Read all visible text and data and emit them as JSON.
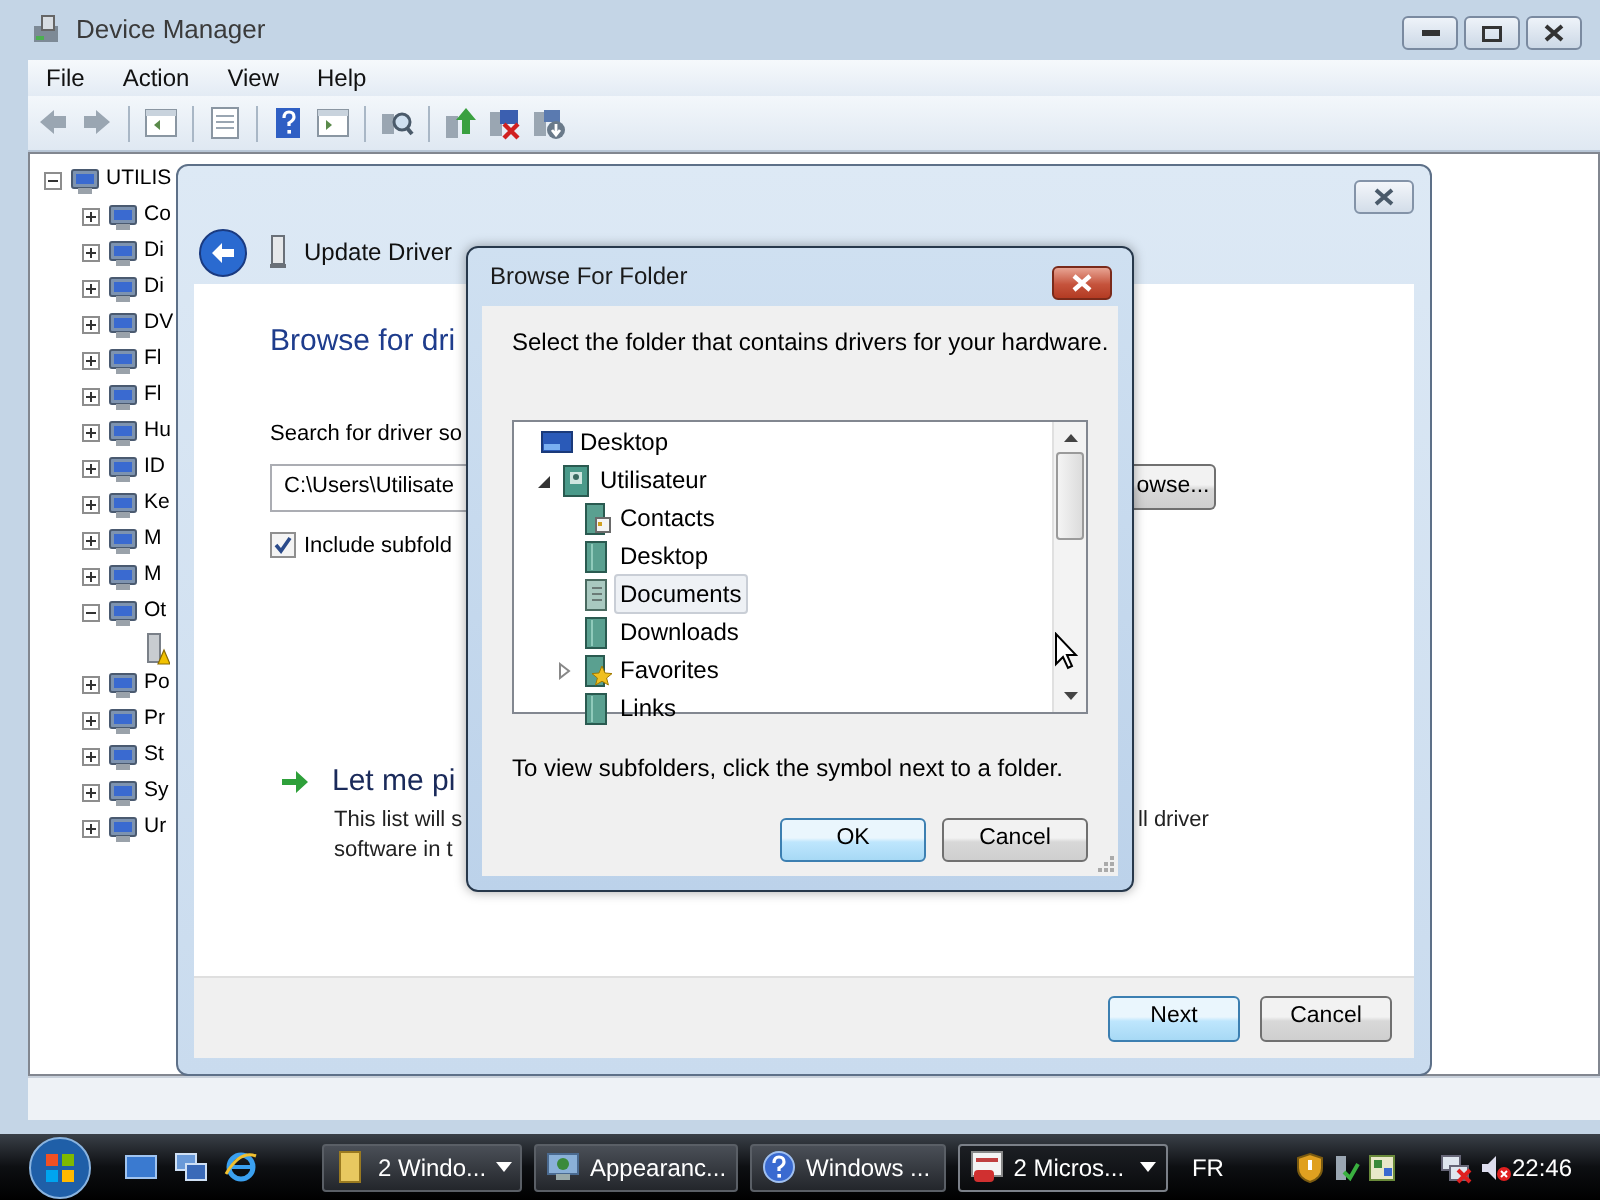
{
  "device_manager": {
    "title": "Device Manager",
    "menu": [
      "File",
      "Action",
      "View",
      "Help"
    ],
    "tree": {
      "label": "UTILIS",
      "expanded": true,
      "children": [
        {
          "label": "Co",
          "expanded": false
        },
        {
          "label": "Di",
          "expanded": false
        },
        {
          "label": "Di",
          "expanded": false
        },
        {
          "label": "DV",
          "expanded": false
        },
        {
          "label": "Fl",
          "expanded": false
        },
        {
          "label": "Fl",
          "expanded": false
        },
        {
          "label": "Hu",
          "expanded": false
        },
        {
          "label": "ID",
          "expanded": false
        },
        {
          "label": "Ke",
          "expanded": false
        },
        {
          "label": "M",
          "expanded": false
        },
        {
          "label": "M",
          "expanded": false
        },
        {
          "label": "Ot",
          "expanded": true,
          "children": [
            {
              "warning": true
            }
          ]
        },
        {
          "label": "Po",
          "expanded": false
        },
        {
          "label": "Pr",
          "expanded": false
        },
        {
          "label": "St",
          "expanded": false
        },
        {
          "label": "Sy",
          "expanded": false
        },
        {
          "label": "Ur",
          "expanded": false
        }
      ]
    }
  },
  "wizard": {
    "title": "Update Driver",
    "heading": "Browse for dri",
    "search_label": "Search for driver so",
    "path": "C:\\Users\\Utilisate",
    "browse_button": "owse...",
    "include_subfolders": {
      "label": "Include subfold",
      "checked": true
    },
    "pick_link": "Let me pi",
    "pick_description": [
      "This list will s",
      "software in t"
    ],
    "pick_description_right": "ll driver",
    "buttons": [
      "Next",
      "Cancel"
    ]
  },
  "browse_dialog": {
    "title": "Browse For Folder",
    "instruction": "Select the folder that contains drivers for your hardware.",
    "tree": [
      {
        "label": "Desktop",
        "kind": "desktop",
        "selected": false,
        "children": [
          {
            "label": "Utilisateur",
            "kind": "user",
            "selected": false,
            "expanded": true,
            "children": [
              {
                "label": "Contacts",
                "kind": "contacts",
                "selected": false
              },
              {
                "label": "Desktop",
                "kind": "folder",
                "selected": false
              },
              {
                "label": "Documents",
                "kind": "documents",
                "selected": true
              },
              {
                "label": "Downloads",
                "kind": "folder",
                "selected": false
              },
              {
                "label": "Favorites",
                "kind": "favorites",
                "selected": false,
                "expanded": false
              },
              {
                "label": "Links",
                "kind": "folder",
                "selected": false
              }
            ]
          }
        ]
      }
    ],
    "hint": "To view subfolders, click the symbol next to a folder.",
    "buttons": [
      "OK",
      "Cancel"
    ]
  },
  "taskbar": {
    "tasks": [
      {
        "label": "2 Windo...",
        "kind": "folder",
        "grouped": true,
        "selected": false
      },
      {
        "label": "Appearanc...",
        "kind": "display",
        "grouped": false,
        "selected": false
      },
      {
        "label": "Windows ...",
        "kind": "help",
        "grouped": false,
        "selected": false
      },
      {
        "label": "2 Micros...",
        "kind": "presentation",
        "grouped": true,
        "selected": true
      }
    ],
    "language": "FR",
    "clock": "22:46"
  }
}
